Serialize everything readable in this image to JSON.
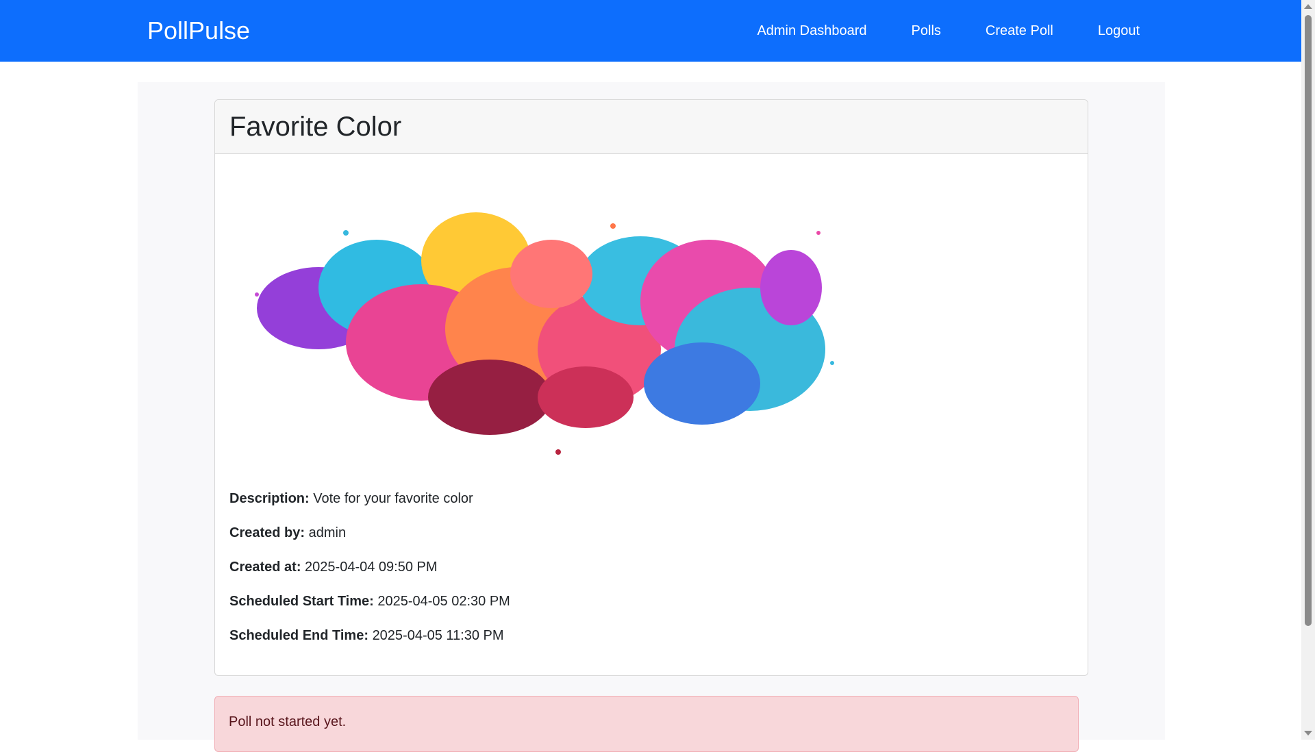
{
  "navbar": {
    "brand": "PollPulse",
    "links": [
      "Admin Dashboard",
      "Polls",
      "Create Poll",
      "Logout"
    ],
    "background": "#0d6efd"
  },
  "poll": {
    "title": "Favorite Color",
    "image_icon": "paint-splash-image",
    "fields": [
      {
        "label": "Description:",
        "value": "Vote for your favorite color"
      },
      {
        "label": "Created by:",
        "value": "admin"
      },
      {
        "label": "Created at:",
        "value": "2025-04-04 09:50 PM"
      },
      {
        "label": "Scheduled Start Time:",
        "value": "2025-04-05 02:30 PM"
      },
      {
        "label": "Scheduled End Time:",
        "value": "2025-04-05 11:30 PM"
      }
    ]
  },
  "alert": {
    "message": "Poll not started yet.",
    "color": "#f8d7da"
  }
}
